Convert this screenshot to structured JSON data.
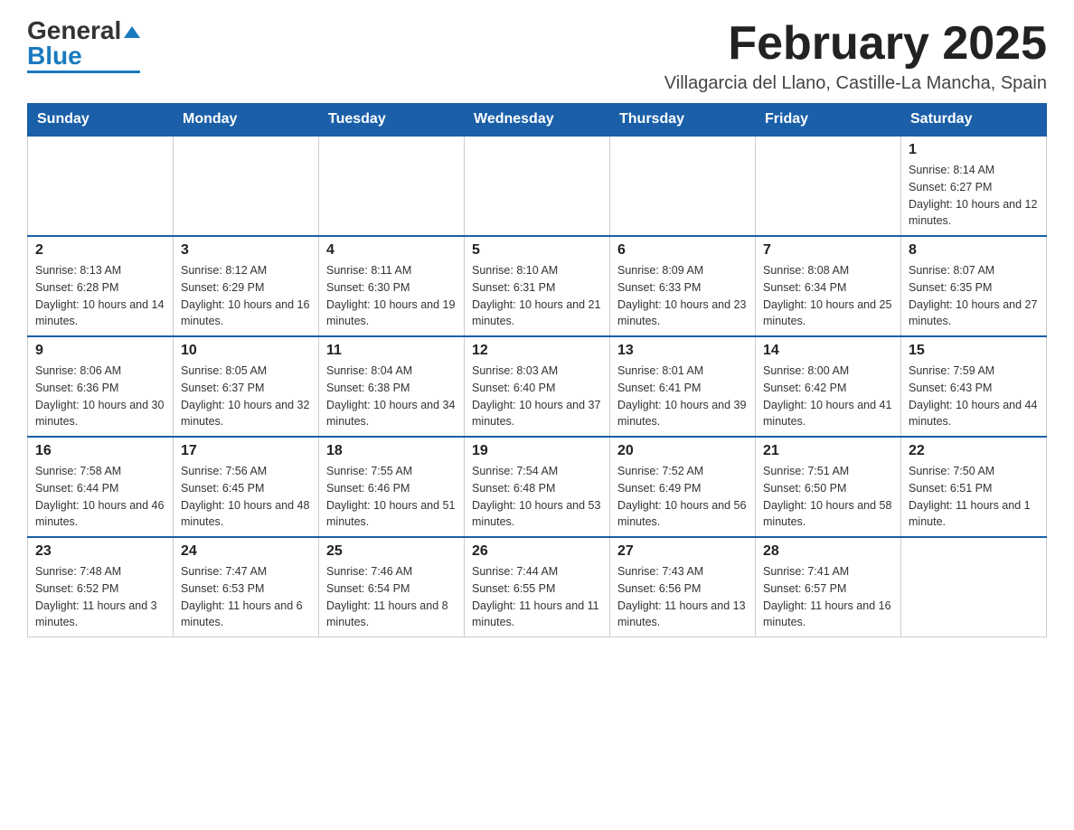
{
  "logo": {
    "general": "General",
    "blue": "Blue"
  },
  "header": {
    "month_year": "February 2025",
    "location": "Villagarcia del Llano, Castille-La Mancha, Spain"
  },
  "days_of_week": [
    "Sunday",
    "Monday",
    "Tuesday",
    "Wednesday",
    "Thursday",
    "Friday",
    "Saturday"
  ],
  "weeks": [
    [
      {
        "day": "",
        "info": ""
      },
      {
        "day": "",
        "info": ""
      },
      {
        "day": "",
        "info": ""
      },
      {
        "day": "",
        "info": ""
      },
      {
        "day": "",
        "info": ""
      },
      {
        "day": "",
        "info": ""
      },
      {
        "day": "1",
        "info": "Sunrise: 8:14 AM\nSunset: 6:27 PM\nDaylight: 10 hours and 12 minutes."
      }
    ],
    [
      {
        "day": "2",
        "info": "Sunrise: 8:13 AM\nSunset: 6:28 PM\nDaylight: 10 hours and 14 minutes."
      },
      {
        "day": "3",
        "info": "Sunrise: 8:12 AM\nSunset: 6:29 PM\nDaylight: 10 hours and 16 minutes."
      },
      {
        "day": "4",
        "info": "Sunrise: 8:11 AM\nSunset: 6:30 PM\nDaylight: 10 hours and 19 minutes."
      },
      {
        "day": "5",
        "info": "Sunrise: 8:10 AM\nSunset: 6:31 PM\nDaylight: 10 hours and 21 minutes."
      },
      {
        "day": "6",
        "info": "Sunrise: 8:09 AM\nSunset: 6:33 PM\nDaylight: 10 hours and 23 minutes."
      },
      {
        "day": "7",
        "info": "Sunrise: 8:08 AM\nSunset: 6:34 PM\nDaylight: 10 hours and 25 minutes."
      },
      {
        "day": "8",
        "info": "Sunrise: 8:07 AM\nSunset: 6:35 PM\nDaylight: 10 hours and 27 minutes."
      }
    ],
    [
      {
        "day": "9",
        "info": "Sunrise: 8:06 AM\nSunset: 6:36 PM\nDaylight: 10 hours and 30 minutes."
      },
      {
        "day": "10",
        "info": "Sunrise: 8:05 AM\nSunset: 6:37 PM\nDaylight: 10 hours and 32 minutes."
      },
      {
        "day": "11",
        "info": "Sunrise: 8:04 AM\nSunset: 6:38 PM\nDaylight: 10 hours and 34 minutes."
      },
      {
        "day": "12",
        "info": "Sunrise: 8:03 AM\nSunset: 6:40 PM\nDaylight: 10 hours and 37 minutes."
      },
      {
        "day": "13",
        "info": "Sunrise: 8:01 AM\nSunset: 6:41 PM\nDaylight: 10 hours and 39 minutes."
      },
      {
        "day": "14",
        "info": "Sunrise: 8:00 AM\nSunset: 6:42 PM\nDaylight: 10 hours and 41 minutes."
      },
      {
        "day": "15",
        "info": "Sunrise: 7:59 AM\nSunset: 6:43 PM\nDaylight: 10 hours and 44 minutes."
      }
    ],
    [
      {
        "day": "16",
        "info": "Sunrise: 7:58 AM\nSunset: 6:44 PM\nDaylight: 10 hours and 46 minutes."
      },
      {
        "day": "17",
        "info": "Sunrise: 7:56 AM\nSunset: 6:45 PM\nDaylight: 10 hours and 48 minutes."
      },
      {
        "day": "18",
        "info": "Sunrise: 7:55 AM\nSunset: 6:46 PM\nDaylight: 10 hours and 51 minutes."
      },
      {
        "day": "19",
        "info": "Sunrise: 7:54 AM\nSunset: 6:48 PM\nDaylight: 10 hours and 53 minutes."
      },
      {
        "day": "20",
        "info": "Sunrise: 7:52 AM\nSunset: 6:49 PM\nDaylight: 10 hours and 56 minutes."
      },
      {
        "day": "21",
        "info": "Sunrise: 7:51 AM\nSunset: 6:50 PM\nDaylight: 10 hours and 58 minutes."
      },
      {
        "day": "22",
        "info": "Sunrise: 7:50 AM\nSunset: 6:51 PM\nDaylight: 11 hours and 1 minute."
      }
    ],
    [
      {
        "day": "23",
        "info": "Sunrise: 7:48 AM\nSunset: 6:52 PM\nDaylight: 11 hours and 3 minutes."
      },
      {
        "day": "24",
        "info": "Sunrise: 7:47 AM\nSunset: 6:53 PM\nDaylight: 11 hours and 6 minutes."
      },
      {
        "day": "25",
        "info": "Sunrise: 7:46 AM\nSunset: 6:54 PM\nDaylight: 11 hours and 8 minutes."
      },
      {
        "day": "26",
        "info": "Sunrise: 7:44 AM\nSunset: 6:55 PM\nDaylight: 11 hours and 11 minutes."
      },
      {
        "day": "27",
        "info": "Sunrise: 7:43 AM\nSunset: 6:56 PM\nDaylight: 11 hours and 13 minutes."
      },
      {
        "day": "28",
        "info": "Sunrise: 7:41 AM\nSunset: 6:57 PM\nDaylight: 11 hours and 16 minutes."
      },
      {
        "day": "",
        "info": ""
      }
    ]
  ]
}
